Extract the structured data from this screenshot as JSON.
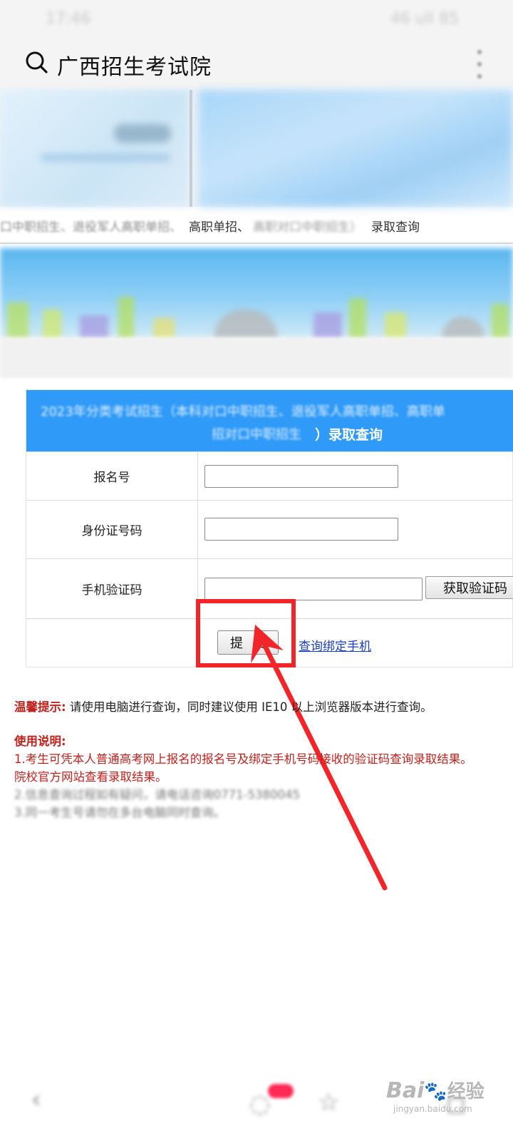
{
  "status_bar": {
    "time": "17:46",
    "icons": "46 ull 85"
  },
  "search": {
    "query": "广西招生考试院"
  },
  "breadcrumb": {
    "blurred_start": "口中职招生、退役军人高职单招、",
    "segment": "高职单招、",
    "blurred_mid": "高职对口中职招生）",
    "segment_end": "录取查询"
  },
  "form": {
    "header_line1": "2023年分类考试招生（本科对口中职招生、退役军人高职单招、高职单",
    "header_line2_blurred": "招对口中职招生",
    "header_line2_clear": "）录取查询",
    "rows": [
      {
        "label": "报名号",
        "value": ""
      },
      {
        "label": "身份证号码",
        "value": ""
      },
      {
        "label": "手机验证码",
        "value": ""
      }
    ],
    "get_code_button": "获取验证码",
    "submit_button": "提交",
    "bind_phone_link": "查询绑定手机"
  },
  "tips": {
    "label": "温馨提示:",
    "text": " 请使用电脑进行查询，同时建议使用 IE10 以上浏览器版本进行查询。"
  },
  "usage": {
    "title": "使用说明:",
    "line1": "1.考生可凭本人普通高考网上报名的报名号及绑定手机号码接收的验证码查询录取结果。",
    "line1b": "院校官方网站查看录取结果。",
    "line2": "2.信息查询过程如有疑问，请电话咨询0771-5380045",
    "line3": "3.同一考生号请勿在多台电脑同时查询。"
  },
  "watermark": {
    "brand": "Bai",
    "brand_cn": "经验",
    "domain": "jingyan.baidu.com"
  },
  "colors": {
    "accent": "#2f9af7",
    "highlight": "#f2262a",
    "warning_text": "#c0221d",
    "link": "#1a3fc4"
  }
}
